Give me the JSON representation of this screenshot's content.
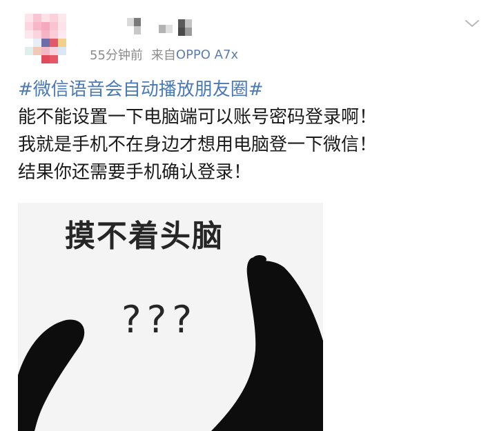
{
  "post": {
    "meta": {
      "time": "55分钟前",
      "source_prefix": "来自",
      "device": "OPPO A7x"
    },
    "topic": "#微信语音会自动播放朋友圈#",
    "lines": [
      "能不能设置一下电脑端可以账号密码登录啊！",
      "我就是手机不在身边才想用电脑登一下微信！",
      "结果你还需要手机确认登录！"
    ],
    "meme": {
      "caption": "摸不着头脑",
      "question": "???"
    }
  },
  "colors": {
    "link": "#4a79b8",
    "meta": "#8b8b8b",
    "device": "#5d7ea8",
    "text": "#1a1a1a"
  },
  "icons": {
    "menu": "chevron-down-icon"
  }
}
